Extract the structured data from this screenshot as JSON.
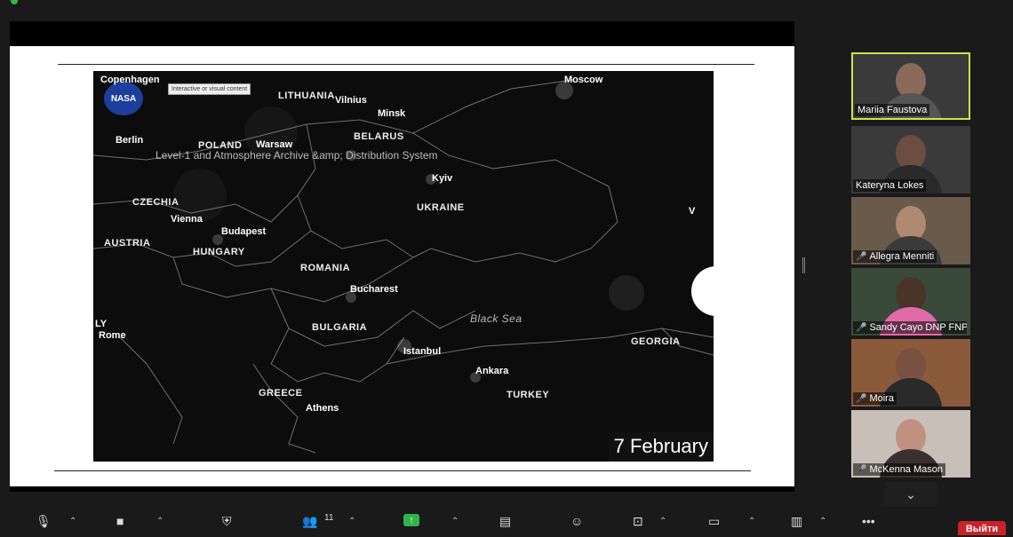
{
  "map": {
    "tooltip": "Interactive or visual content",
    "logo": "NASA",
    "source_text": "Level-1 and Atmosphere Archive &amp; Distribution System",
    "date_badge": "7 February",
    "countries": [
      "LITHUANIA",
      "POLAND",
      "BELARUS",
      "CZECHIA",
      "UKRAINE",
      "AUSTRIA",
      "HUNGARY",
      "ROMANIA",
      "BULGARIA",
      "GREECE",
      "TURKEY",
      "GEORGIA"
    ],
    "cities": [
      "Copenhagen",
      "Moscow",
      "Vilnius",
      "Minsk",
      "Berlin",
      "Warsaw",
      "Kyiv",
      "Vienna",
      "Budapest",
      "Bucharest",
      "Rome",
      "Istanbul",
      "Ankara",
      "Athens"
    ],
    "sea": "Black Sea",
    "frag_ly": "LY",
    "frag_v": "V"
  },
  "participants": [
    {
      "name": "Mariia Faustova",
      "muted": false,
      "active": true
    },
    {
      "name": "Kateryna Lokes",
      "muted": false,
      "active": false
    },
    {
      "name": "Allegra Menniti",
      "muted": true,
      "active": false
    },
    {
      "name": "Sandy Cayo DNP FNP...",
      "muted": true,
      "active": false
    },
    {
      "name": "Moira",
      "muted": true,
      "active": false
    },
    {
      "name": "McKenna Mason",
      "muted": true,
      "active": false
    }
  ],
  "toolbar": {
    "participants_count": "11",
    "leave_label": "Выйти",
    "more_label": "•••"
  },
  "icons": [
    "mic-icon",
    "video-icon",
    "security-icon",
    "participants-icon",
    "share-screen-icon",
    "notes-icon",
    "reactions-icon",
    "apps-icon",
    "whiteboard-icon",
    "more-icon",
    "chevron-down-icon"
  ]
}
